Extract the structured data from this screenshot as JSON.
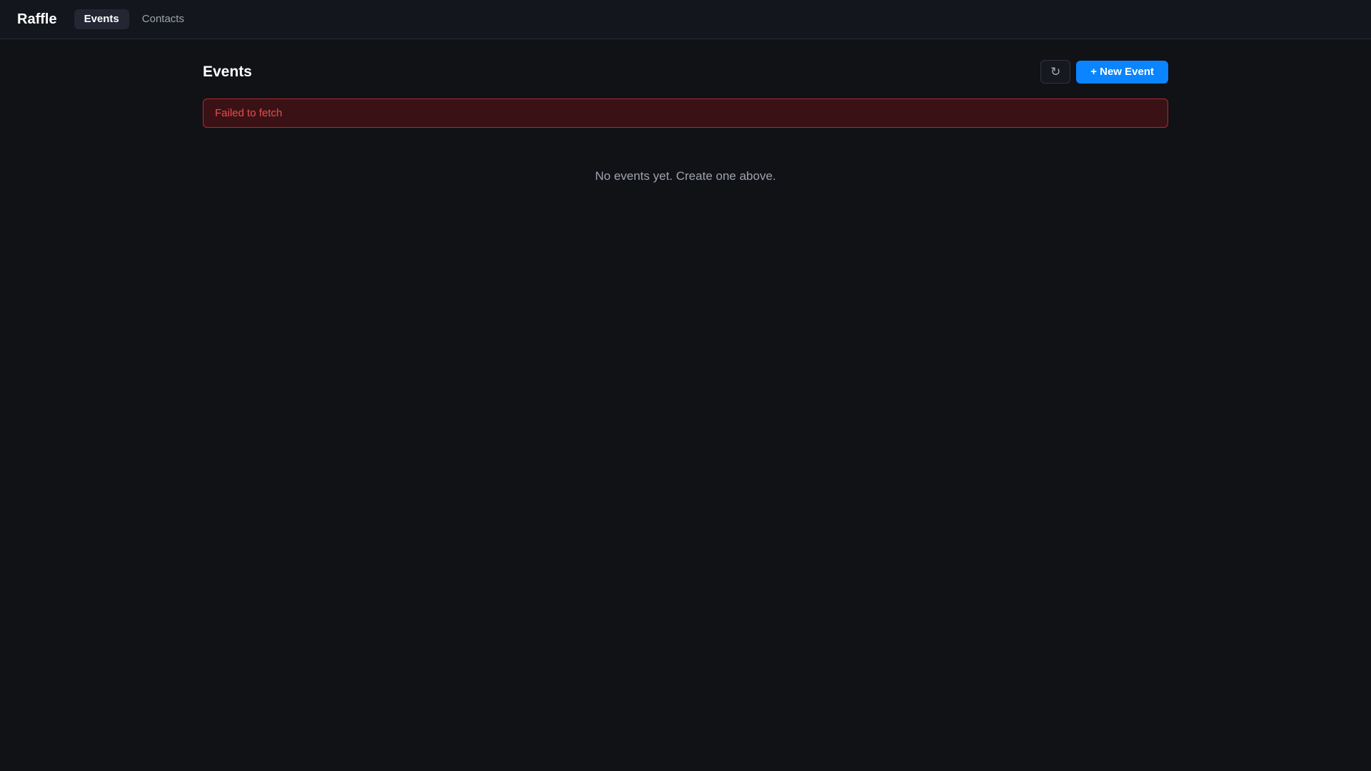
{
  "app": {
    "brand": "Raffle"
  },
  "nav": {
    "items": [
      {
        "label": "Events",
        "active": true
      },
      {
        "label": "Contacts",
        "active": false
      }
    ]
  },
  "page": {
    "title": "Events",
    "refresh_icon": "↻",
    "new_event_label": "+ New Event"
  },
  "error": {
    "message": "Failed to fetch"
  },
  "empty_state": {
    "message": "No events yet. Create one above."
  },
  "colors": {
    "accent": "#0a84ff",
    "error_text": "#ef4a4a",
    "error_border": "#b3282d",
    "error_bg": "#3a1215",
    "background": "#111216"
  }
}
